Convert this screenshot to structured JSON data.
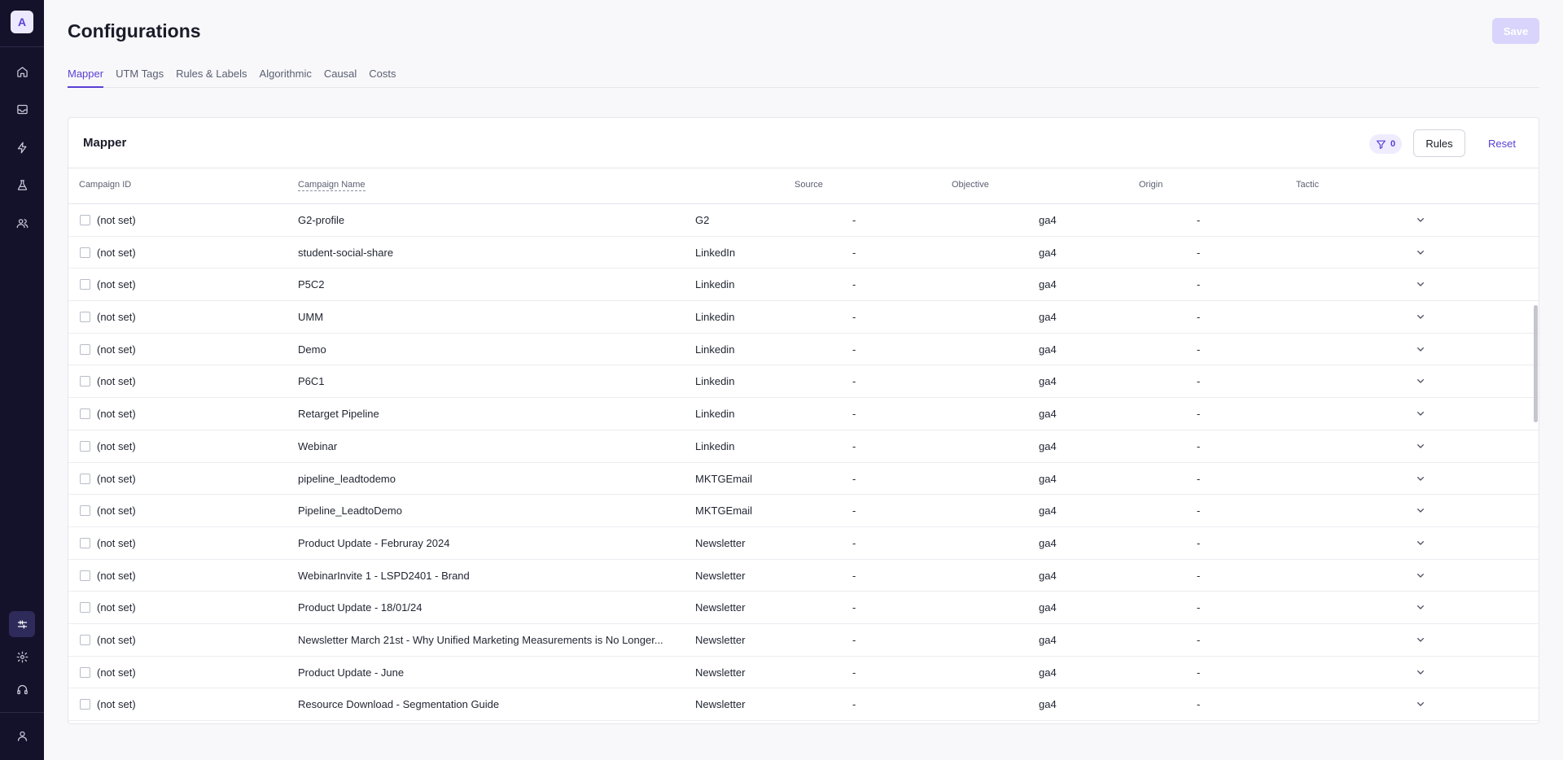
{
  "sidebar": {
    "logo_letter": "A",
    "top_icons": [
      "home-icon",
      "inbox-icon",
      "lightning-icon",
      "flask-icon",
      "users-icon"
    ],
    "bottom_icons": [
      "sliders-icon",
      "gear-icon",
      "headset-icon",
      "user-icon"
    ],
    "active": "sliders-icon"
  },
  "header": {
    "title": "Configurations",
    "save_label": "Save"
  },
  "tabs": [
    {
      "label": "Mapper",
      "active": true
    },
    {
      "label": "UTM Tags"
    },
    {
      "label": "Rules & Labels"
    },
    {
      "label": "Algorithmic"
    },
    {
      "label": "Causal"
    },
    {
      "label": "Costs"
    }
  ],
  "card": {
    "title": "Mapper",
    "filter_count": "0",
    "rules_label": "Rules",
    "reset_label": "Reset"
  },
  "table": {
    "columns": {
      "campaign_id": "Campaign ID",
      "campaign_name": "Campaign Name",
      "source": "Source",
      "objective": "Objective",
      "origin": "Origin",
      "tactic": "Tactic"
    },
    "rows": [
      {
        "id": "(not set)",
        "name": "G2-profile",
        "source": "G2",
        "objective": "-",
        "origin": "ga4",
        "tactic": "-"
      },
      {
        "id": "(not set)",
        "name": "student-social-share",
        "source": "LinkedIn",
        "objective": "-",
        "origin": "ga4",
        "tactic": "-"
      },
      {
        "id": "(not set)",
        "name": "P5C2",
        "source": "Linkedin",
        "objective": "-",
        "origin": "ga4",
        "tactic": "-"
      },
      {
        "id": "(not set)",
        "name": "UMM",
        "source": "Linkedin",
        "objective": "-",
        "origin": "ga4",
        "tactic": "-"
      },
      {
        "id": "(not set)",
        "name": "Demo",
        "source": "Linkedin",
        "objective": "-",
        "origin": "ga4",
        "tactic": "-"
      },
      {
        "id": "(not set)",
        "name": "P6C1",
        "source": "Linkedin",
        "objective": "-",
        "origin": "ga4",
        "tactic": "-"
      },
      {
        "id": "(not set)",
        "name": "Retarget Pipeline",
        "source": "Linkedin",
        "objective": "-",
        "origin": "ga4",
        "tactic": "-"
      },
      {
        "id": "(not set)",
        "name": "Webinar",
        "source": "Linkedin",
        "objective": "-",
        "origin": "ga4",
        "tactic": "-"
      },
      {
        "id": "(not set)",
        "name": "pipeline_leadtodemo",
        "source": "MKTGEmail",
        "objective": "-",
        "origin": "ga4",
        "tactic": "-"
      },
      {
        "id": "(not set)",
        "name": "Pipeline_LeadtoDemo",
        "source": "MKTGEmail",
        "objective": "-",
        "origin": "ga4",
        "tactic": "-"
      },
      {
        "id": "(not set)",
        "name": "Product Update - Februray 2024",
        "source": "Newsletter",
        "objective": "-",
        "origin": "ga4",
        "tactic": "-"
      },
      {
        "id": "(not set)",
        "name": "WebinarInvite 1 - LSPD2401 - Brand",
        "source": "Newsletter",
        "objective": "-",
        "origin": "ga4",
        "tactic": "-"
      },
      {
        "id": "(not set)",
        "name": "Product Update - 18/01/24",
        "source": "Newsletter",
        "objective": "-",
        "origin": "ga4",
        "tactic": "-"
      },
      {
        "id": "(not set)",
        "name": "Newsletter March 21st - Why Unified Marketing Measurements is No Longer...",
        "source": "Newsletter",
        "objective": "-",
        "origin": "ga4",
        "tactic": "-"
      },
      {
        "id": "(not set)",
        "name": "Product Update - June",
        "source": "Newsletter",
        "objective": "-",
        "origin": "ga4",
        "tactic": "-"
      },
      {
        "id": "(not set)",
        "name": "Resource Download - Segmentation Guide",
        "source": "Newsletter",
        "objective": "-",
        "origin": "ga4",
        "tactic": "-"
      }
    ]
  },
  "colors": {
    "accent": "#5b3fd6",
    "sidebar_bg": "#14122b",
    "save_disabled": "#d9d4fb"
  }
}
